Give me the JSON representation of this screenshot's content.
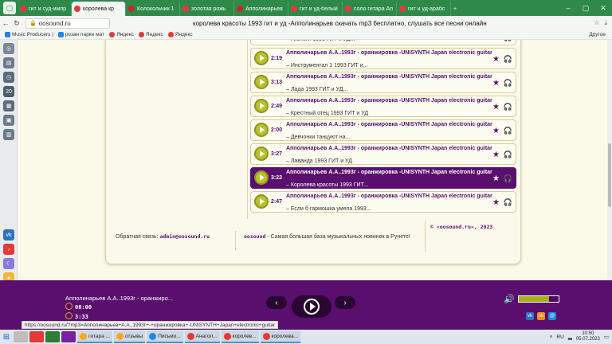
{
  "browser": {
    "tabs": [
      {
        "label": "гит и суд-импр",
        "color": "#e53935",
        "active": false
      },
      {
        "label": "королева кр",
        "color": "#e53935",
        "active": true
      },
      {
        "label": "Колокольчик 1",
        "color": "#c62828",
        "active": false
      },
      {
        "label": "золотая рожь",
        "color": "#e53935",
        "active": false
      },
      {
        "label": "Апполинарьев",
        "color": "#c62828",
        "active": false
      },
      {
        "label": "гит и уд-белый",
        "color": "#e53935",
        "active": false
      },
      {
        "label": "соло гитара Ап",
        "color": "#e53935",
        "active": false
      },
      {
        "label": "гит и уд-арабс",
        "color": "#e53935",
        "active": false
      }
    ],
    "url": "oosound.ru",
    "page_title": "королева красоты 1993 гит и уд -Апполинарьев скачать mp3 бесплатно, слушать все песни онлайн",
    "bookmarks": [
      "Music Producers |",
      "розан парке мат",
      "Яндекс",
      "Яндекс",
      "Яндекс"
    ],
    "other_bookmarks": "Другое"
  },
  "tracks": [
    {
      "duration": "2:59",
      "title": "guitar",
      "subtitle": "– Геологи 1993 ГИТ и УД...",
      "cut": true,
      "active": false
    },
    {
      "duration": "2:19",
      "title": "Апполинарьев А.А..1993г - оранжировка -UNISYNTH Japan electronic guitar",
      "subtitle": "– Инструментал 1 1993 ГИТ и...",
      "cut": false,
      "active": false
    },
    {
      "duration": "3:13",
      "title": "Апполинарьев А.А..1993г - оранжировка -UNISYNTH Japan electronic guitar",
      "subtitle": "– Лада 1993 ГИТ и УД...",
      "cut": false,
      "active": false
    },
    {
      "duration": "2:49",
      "title": "Апполинарьев А.А..1993г - оранжировка -UNISYNTH Japan electronic guitar",
      "subtitle": "– Крестный отец 1993 ГИТ и УД",
      "cut": false,
      "active": false
    },
    {
      "duration": "2:00",
      "title": "Апполинарьев А.А..1993г - оранжировка -UNISYNTH Japan electronic guitar",
      "subtitle": "– Девчонки танцуют на...",
      "cut": false,
      "active": false
    },
    {
      "duration": "3:27",
      "title": "Апполинарьев А.А..1993г - оранжировка -UNISYNTH Japan electronic guitar",
      "subtitle": "– Лаванда 1993 ГИТ и УД",
      "cut": false,
      "active": false
    },
    {
      "duration": "3:22",
      "title": "Апполинарьев А.А..1993г - оранжировка -UNISYNTH Japan electronic guitar",
      "subtitle": "– Королева красоты 1993 ГИТ...",
      "cut": false,
      "active": true
    },
    {
      "duration": "2:47",
      "title": "Апполинарьев А.А..1993г - оранжировка -UNISYNTH Japan electronic guitar",
      "subtitle": "– Если б гармошка умела 1993...",
      "cut": false,
      "active": false
    }
  ],
  "footer": {
    "contact_label": "Обратная связь:",
    "contact_email": "admin@oosound.ru",
    "brand": "oosound",
    "tagline": " - Самая большая база музыкальных новинок в Рунете!",
    "copyright": "© «oosound.ru», 2023"
  },
  "player": {
    "title": "Апполинарьев А.А..1993г - оранжиро...",
    "elapsed": "00:00",
    "total": "3:33",
    "volume_fraction": 0.75,
    "accent": "#5a0e6e",
    "volume_color": "#a1b01a"
  },
  "status_url": "https://oosound.ru/?mp3=Апполинарьев+А.А..1993г+-+оранжировка+-UNISYNTH+Japan+electronic+guitar",
  "taskbar": {
    "windows": [
      "гитара ...",
      "отзывы",
      "Письмо...",
      "Анатол...",
      "королев...",
      "королева..."
    ],
    "lang": "RU",
    "time": "10:50",
    "date": "05.07.2023"
  }
}
